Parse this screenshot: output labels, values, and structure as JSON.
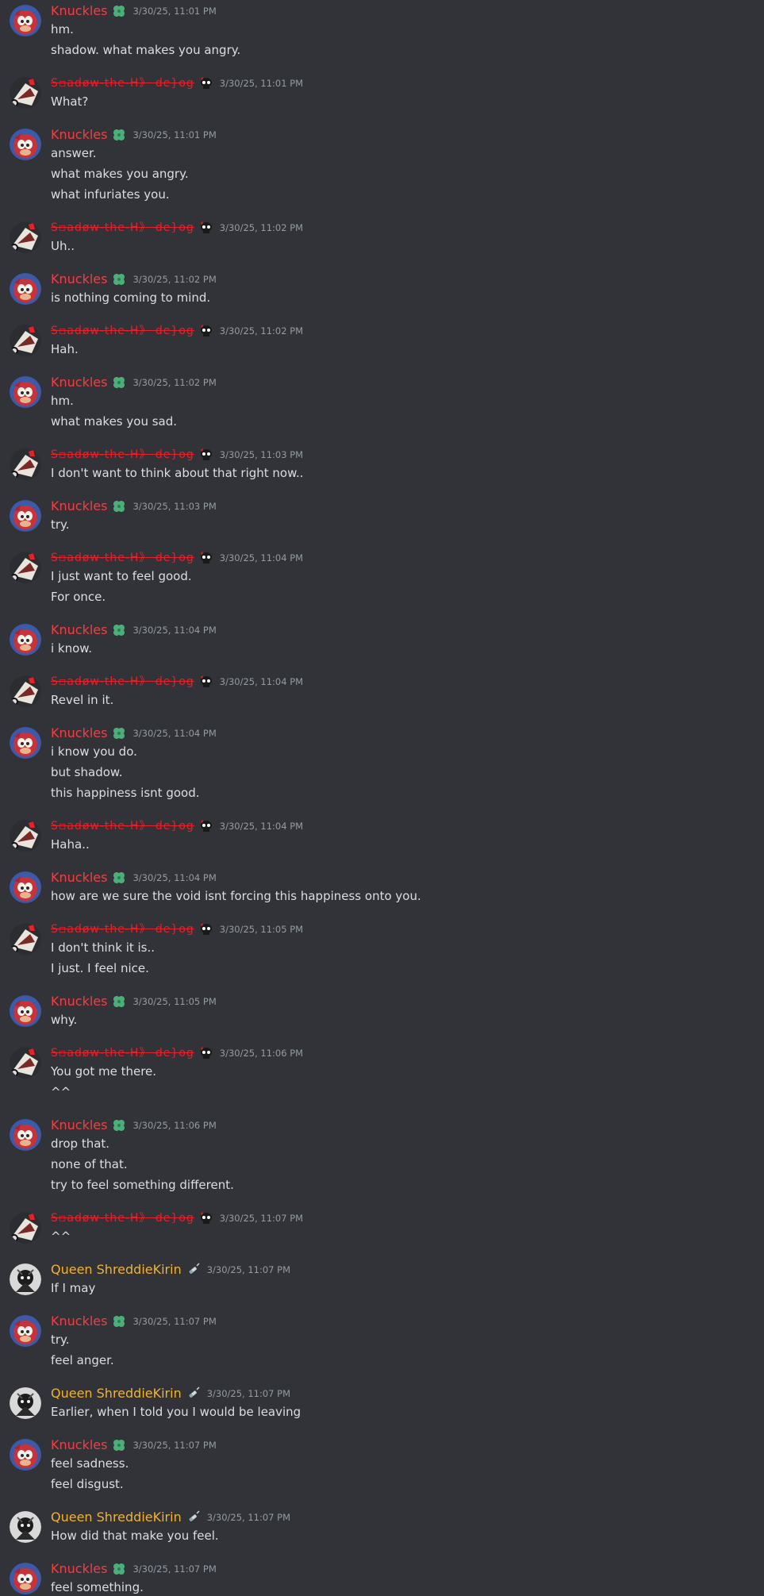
{
  "users": {
    "knuckles": "Knuckles",
    "shadow": "S▫adøw-the-H》 de}og",
    "queen": "Queen ShreddieKirin"
  },
  "colors": {
    "background": "#313338",
    "knuckles": "#f23f43",
    "shadow": "#e8202a",
    "queen": "#f0b232",
    "timestamp": "#949ba4",
    "text": "#dbdee1"
  },
  "icons": {
    "knuckles_role": "clover-icon",
    "shadow_role": "skull-icon",
    "queen_role": "syringe-icon"
  },
  "groups": [
    {
      "user": "knuckles",
      "time": "3/30/25, 11:01 PM",
      "lines": [
        "hm.",
        "shadow. what makes you angry."
      ]
    },
    {
      "user": "shadow",
      "time": "3/30/25, 11:01 PM",
      "lines": [
        "What?"
      ]
    },
    {
      "user": "knuckles",
      "time": "3/30/25, 11:01 PM",
      "lines": [
        "answer.",
        "what makes you angry.",
        "what infuriates you."
      ]
    },
    {
      "user": "shadow",
      "time": "3/30/25, 11:02 PM",
      "lines": [
        "Uh.."
      ]
    },
    {
      "user": "knuckles",
      "time": "3/30/25, 11:02 PM",
      "lines": [
        "is nothing coming to mind."
      ]
    },
    {
      "user": "shadow",
      "time": "3/30/25, 11:02 PM",
      "lines": [
        "Hah."
      ]
    },
    {
      "user": "knuckles",
      "time": "3/30/25, 11:02 PM",
      "lines": [
        "hm.",
        "what makes you sad."
      ]
    },
    {
      "user": "shadow",
      "time": "3/30/25, 11:03 PM",
      "lines": [
        "I don't want to think about that right now.."
      ]
    },
    {
      "user": "knuckles",
      "time": "3/30/25, 11:03 PM",
      "lines": [
        "try."
      ]
    },
    {
      "user": "shadow",
      "time": "3/30/25, 11:04 PM",
      "lines": [
        "I just want to feel good.",
        "For once."
      ]
    },
    {
      "user": "knuckles",
      "time": "3/30/25, 11:04 PM",
      "lines": [
        "i know."
      ]
    },
    {
      "user": "shadow",
      "time": "3/30/25, 11:04 PM",
      "lines": [
        "Revel in it."
      ]
    },
    {
      "user": "knuckles",
      "time": "3/30/25, 11:04 PM",
      "lines": [
        "i know you do.",
        "but shadow.",
        "this happiness isnt good."
      ]
    },
    {
      "user": "shadow",
      "time": "3/30/25, 11:04 PM",
      "lines": [
        "Haha.."
      ]
    },
    {
      "user": "knuckles",
      "time": "3/30/25, 11:04 PM",
      "lines": [
        "how are we sure the void isnt forcing this happiness onto you."
      ]
    },
    {
      "user": "shadow",
      "time": "3/30/25, 11:05 PM",
      "lines": [
        "I don't think it is..",
        "I just. I feel nice."
      ]
    },
    {
      "user": "knuckles",
      "time": "3/30/25, 11:05 PM",
      "lines": [
        "why."
      ]
    },
    {
      "user": "shadow",
      "time": "3/30/25, 11:06 PM",
      "lines": [
        "You got me there.",
        "^^"
      ]
    },
    {
      "user": "knuckles",
      "time": "3/30/25, 11:06 PM",
      "lines": [
        "drop that.",
        "none of that.",
        "try to feel something different."
      ]
    },
    {
      "user": "shadow",
      "time": "3/30/25, 11:07 PM",
      "lines": [
        "^^"
      ]
    },
    {
      "user": "queen",
      "time": "3/30/25, 11:07 PM",
      "lines": [
        "If I may"
      ]
    },
    {
      "user": "knuckles",
      "time": "3/30/25, 11:07 PM",
      "lines": [
        "try.",
        "feel anger."
      ]
    },
    {
      "user": "queen",
      "time": "3/30/25, 11:07 PM",
      "lines": [
        "Earlier, when I told you I would be leaving"
      ]
    },
    {
      "user": "knuckles",
      "time": "3/30/25, 11:07 PM",
      "lines": [
        "feel sadness.",
        "feel disgust."
      ]
    },
    {
      "user": "queen",
      "time": "3/30/25, 11:07 PM",
      "lines": [
        "How did that make you feel."
      ]
    },
    {
      "user": "knuckles",
      "time": "3/30/25, 11:07 PM",
      "lines": [
        "feel something."
      ]
    }
  ]
}
